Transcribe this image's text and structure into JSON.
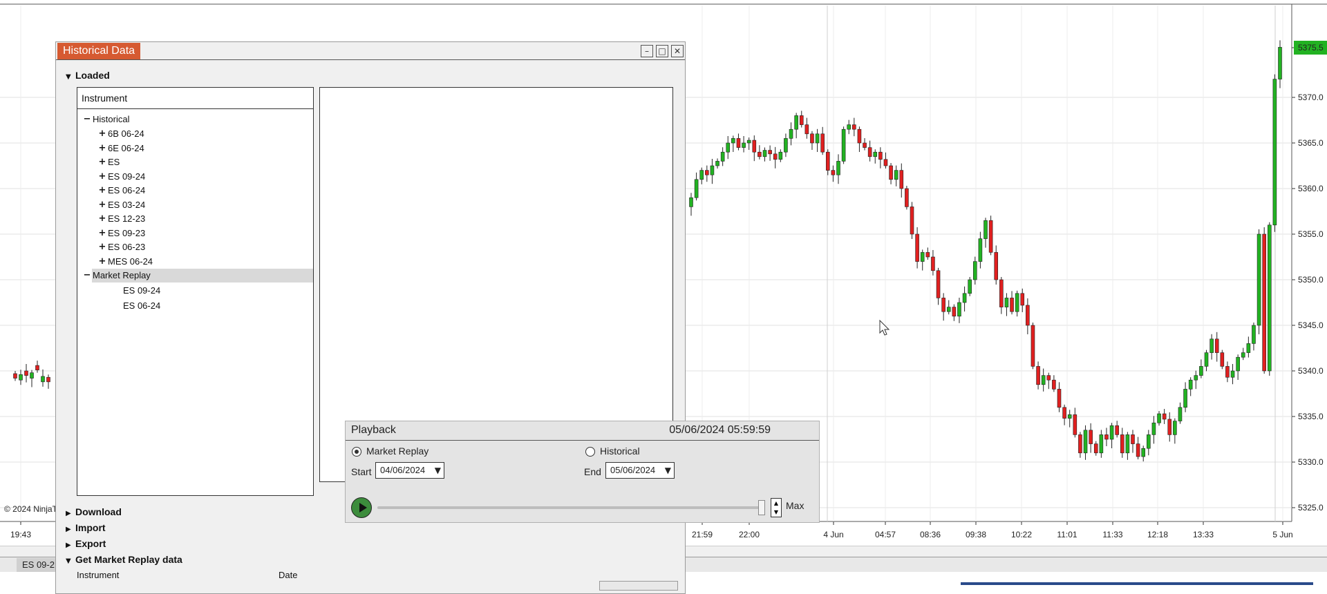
{
  "chart": {
    "tab_label": "ES 09-2",
    "copyright": "© 2024 NinjaT",
    "time_labels": [
      "19:43",
      "21:59",
      "22:00",
      "4 Jun",
      "04:57",
      "08:36",
      "09:38",
      "10:22",
      "11:01",
      "11:33",
      "12:18",
      "13:33",
      "5 Jun"
    ],
    "price_labels": [
      "5375.5",
      "5370.0",
      "5365.0",
      "5360.0",
      "5355.0",
      "5350.0",
      "5345.0",
      "5340.0",
      "5335.0",
      "5330.0",
      "5325.0"
    ],
    "current_price": "5375.5",
    "up_color": "#22b222",
    "down_color": "#e02020"
  },
  "historical_window": {
    "title": "Historical Data",
    "loaded_label": "Loaded",
    "instrument_header": "Instrument",
    "tree": {
      "historical_label": "Historical",
      "historical_items": [
        "6B 06-24",
        "6E 06-24",
        "ES",
        "ES 09-24",
        "ES 06-24",
        "ES 03-24",
        "ES 12-23",
        "ES 09-23",
        "ES 06-23",
        "MES 06-24"
      ],
      "market_replay_label": "Market Replay",
      "market_replay_items": [
        "ES 09-24",
        "ES 06-24"
      ]
    },
    "sections": {
      "download": "Download",
      "import": "Import",
      "export": "Export",
      "get_market_replay": "Get Market Replay data"
    },
    "bottom_columns": {
      "instrument": "Instrument",
      "date": "Date"
    }
  },
  "playback": {
    "title": "Playback",
    "timestamp": "05/06/2024 05:59:59",
    "mode_market_replay": "Market Replay",
    "mode_historical": "Historical",
    "selected_mode": "Market Replay",
    "start_label": "Start",
    "start_value": "04/06/2024",
    "end_label": "End",
    "end_value": "05/06/2024",
    "speed_label": "Max"
  }
}
